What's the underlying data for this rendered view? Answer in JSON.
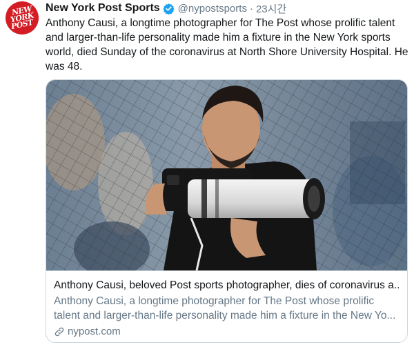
{
  "tweet": {
    "author_name": "New York Post Sports",
    "author_handle": "@nypostsports",
    "separator": "·",
    "time": "23시간",
    "avatar_text": [
      "NEW",
      "YORK",
      "POST"
    ],
    "text": "Anthony Causi, a longtime photographer for The Post whose prolific talent and larger-than-life personality made him a fixture in the New York sports world, died Sunday of the coronavirus at North Shore University Hospital. He was 48."
  },
  "card": {
    "title": "Anthony Causi, beloved Post sports photographer, dies of coronavirus a...",
    "description_lines": [
      "Anthony Causi, a longtime photographer for The Post whose prolific",
      "talent and larger-than-life personality made him a fixture in the New Yo..."
    ],
    "domain": "nypost.com"
  },
  "colors": {
    "brand_red": "#d41c24",
    "verified_blue": "#1da1f2",
    "secondary_text": "#657786",
    "border": "#ccd6dd"
  },
  "icons": [
    "verified-badge-icon",
    "link-icon"
  ]
}
